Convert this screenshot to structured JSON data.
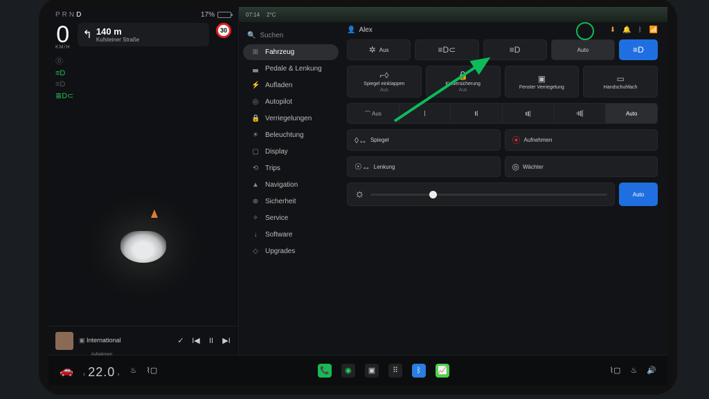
{
  "status": {
    "gear_p": "P",
    "gear_r": "R",
    "gear_n": "N",
    "gear_d": "D",
    "batt_pct": "17%",
    "time": "07:14",
    "temp": "2°C"
  },
  "drive": {
    "speed": "0",
    "unit": "KM/H",
    "nav_dist": "140 m",
    "nav_street": "Kufsteiner Straße",
    "speed_limit": "30"
  },
  "media": {
    "title": "International"
  },
  "search": {
    "placeholder": "Suchen"
  },
  "menu": {
    "items": [
      {
        "icon": "⊞",
        "label": "Fahrzeug"
      },
      {
        "icon": "▃",
        "label": "Pedale & Lenkung"
      },
      {
        "icon": "⚡",
        "label": "Aufladen"
      },
      {
        "icon": "◎",
        "label": "Autopilot"
      },
      {
        "icon": "🔒",
        "label": "Verriegelungen"
      },
      {
        "icon": "☀",
        "label": "Beleuchtung"
      },
      {
        "icon": "▢",
        "label": "Display"
      },
      {
        "icon": "⟲",
        "label": "Trips"
      },
      {
        "icon": "▲",
        "label": "Navigation"
      },
      {
        "icon": "⊕",
        "label": "Sicherheit"
      },
      {
        "icon": "✧",
        "label": "Service"
      },
      {
        "icon": "↓",
        "label": "Software"
      },
      {
        "icon": "◇",
        "label": "Upgrades"
      }
    ]
  },
  "panel": {
    "user": "Alex",
    "lights": {
      "off": "Aus",
      "park": "≡D⊂",
      "auto": "Auto"
    },
    "row2": {
      "mirror_t": "Spiegel einklappen",
      "mirror_s": "Aus",
      "child_t": "Kindersicherung",
      "child_s": "Aus",
      "window_t": "Fenster Verriegelung",
      "glove_t": "Handschuhfach"
    },
    "wipers": {
      "off": "Aus",
      "auto": "Auto"
    },
    "row4": {
      "mirror": "Spiegel",
      "record": "Aufnehmen",
      "steer": "Lenkung",
      "sentry": "Wächter"
    },
    "bright_auto": "Auto"
  },
  "dock": {
    "warm": "Aufwärmen",
    "temp": "22.0"
  }
}
